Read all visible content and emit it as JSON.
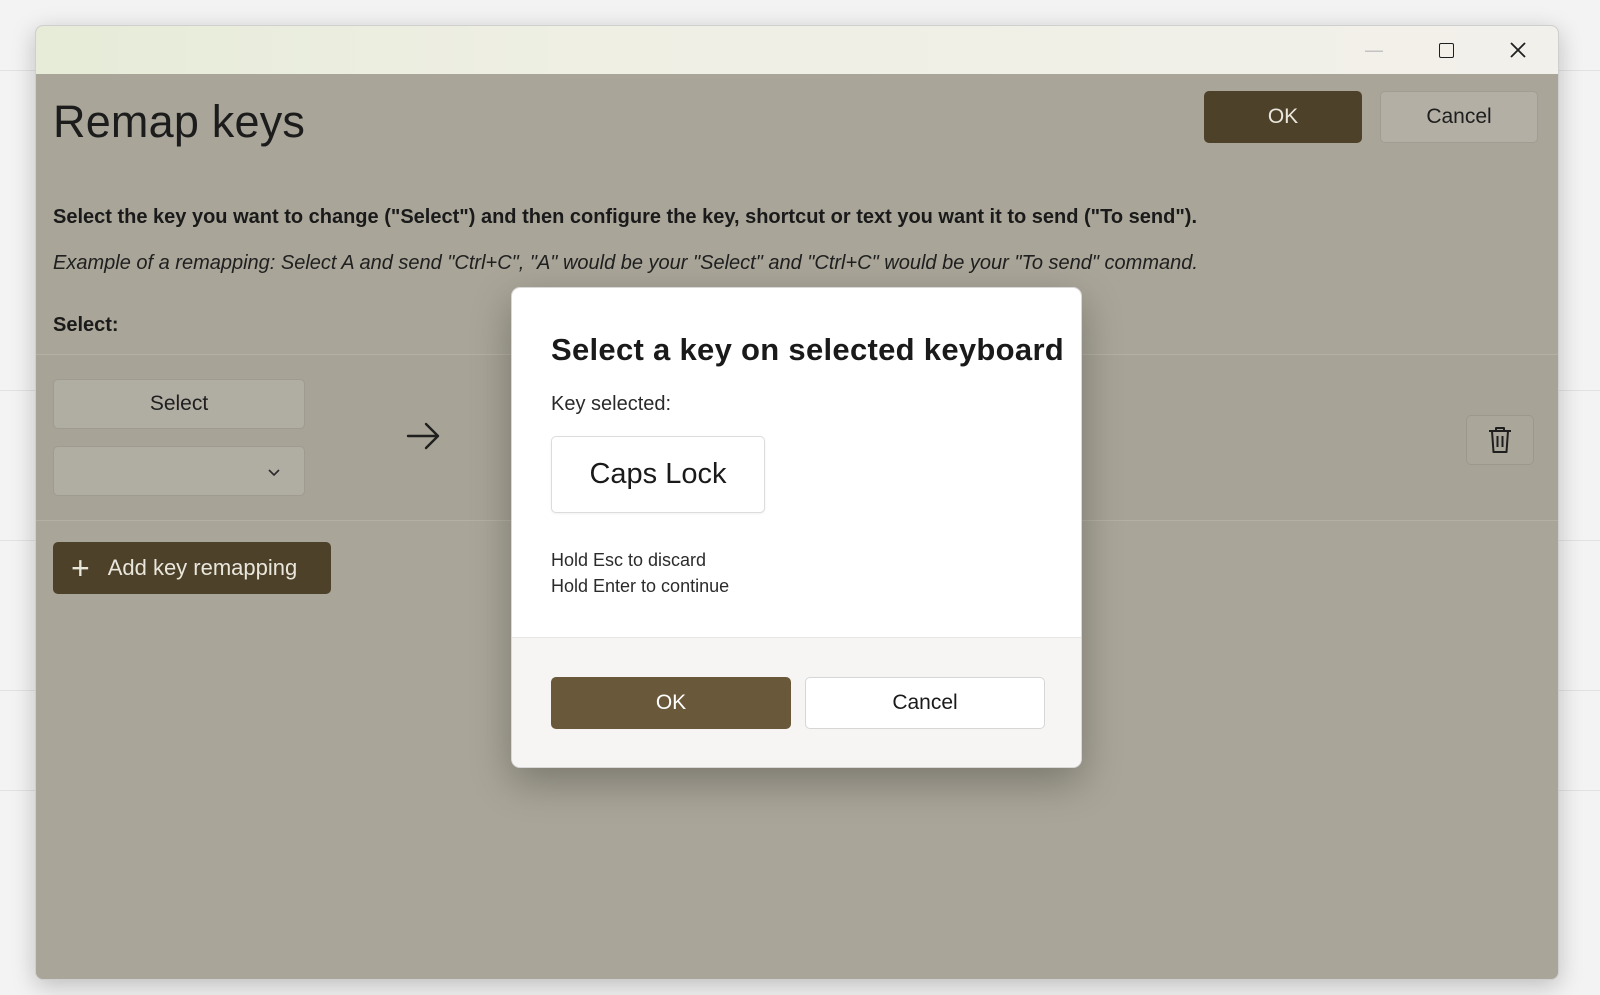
{
  "window": {
    "title": "Remap keys",
    "ok_label": "OK",
    "cancel_label": "Cancel"
  },
  "content": {
    "description": "Select the key you want to change (\"Select\") and then configure the key, shortcut or text you want it to send (\"To send\").",
    "example": "Example of a remapping: Select A and send \"Ctrl+C\", \"A\" would be your \"Select\" and \"Ctrl+C\" would be your \"To send\" command.",
    "select_heading": "Select:",
    "select_button_label": "Select",
    "combo_value": "",
    "add_remapping_label": "Add key remapping"
  },
  "dialog": {
    "title": "Select a key on selected keyboard",
    "key_selected_label": "Key selected:",
    "selected_key": "Caps Lock",
    "hint_discard": "Hold Esc to discard",
    "hint_continue": "Hold Enter to continue",
    "ok_label": "OK",
    "cancel_label": "Cancel"
  },
  "icons": {
    "minimize": "minimize-icon",
    "maximize": "maximize-icon",
    "close": "close-icon",
    "chevron": "chevron-down-icon",
    "arrow": "arrow-right-icon",
    "trash": "trash-icon",
    "plus": "plus-icon"
  },
  "colors": {
    "accent_dark": "#4d4129",
    "accent_dialog": "#6a583b",
    "overlay_bg": "#a9a598"
  }
}
